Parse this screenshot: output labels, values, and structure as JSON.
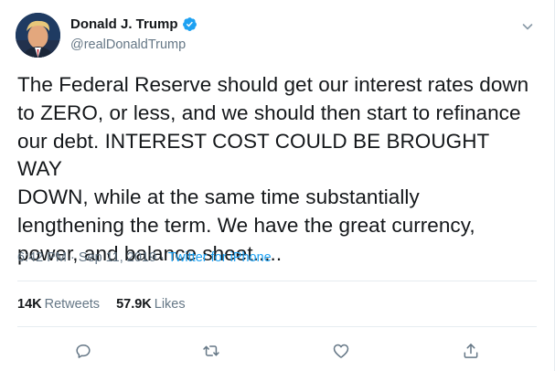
{
  "tweet": {
    "display_name": "Donald J. Trump",
    "handle": "@realDonaldTrump",
    "text": "The Federal Reserve should get our interest rates down\nto ZERO, or less, and we should then start to refinance\nour debt. INTEREST COST COULD BE BROUGHT WAY\nDOWN, while at the same time substantially\nlengthening the term. We have the great currency,\npower, and balance sheet.....",
    "time": "6:42 PM",
    "date": "Sep 11, 2019",
    "separator": "·",
    "source": "Twitter for iPhone"
  },
  "stats": {
    "retweets_count": "14K",
    "retweets_label": "Retweets",
    "likes_count": "57.9K",
    "likes_label": "Likes"
  },
  "icons": {
    "verified": "verified-badge-icon",
    "more": "chevron-down-icon",
    "reply": "reply-icon",
    "retweet": "retweet-icon",
    "like": "heart-icon",
    "share": "share-icon"
  },
  "colors": {
    "accent": "#1da1f2",
    "text": "#14171a",
    "secondary": "#657786",
    "divider": "#e6ecf0"
  }
}
